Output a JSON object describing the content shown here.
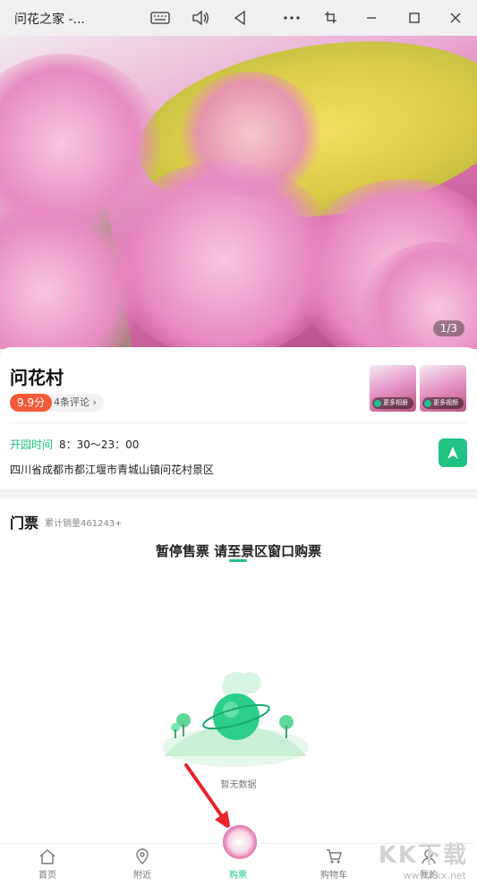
{
  "window": {
    "title": "问花之家 -..."
  },
  "hero": {
    "counter": "1/3"
  },
  "place": {
    "name": "问花村",
    "score": "9.9分",
    "reviews": "4条评论",
    "thumbs": [
      "更多相册",
      "更多视频"
    ],
    "hours_label": "开园时间",
    "hours_value": "8：30～23：00",
    "address": "四川省成都市都江堰市青城山镇问花村景区"
  },
  "tickets": {
    "title": "门票",
    "sales": "累计销量461243+",
    "notice": "暂停售票  请至景区窗口购票",
    "empty_text": "暂无数据"
  },
  "tabbar": {
    "home": "首页",
    "nearby": "附近",
    "buy": "购票",
    "cart": "购物车",
    "mine": "我的"
  },
  "watermark": {
    "main": "KK下载",
    "sub": "www.kkx.net"
  },
  "colors": {
    "accent": "#21c285",
    "score": "#f25a3a"
  }
}
